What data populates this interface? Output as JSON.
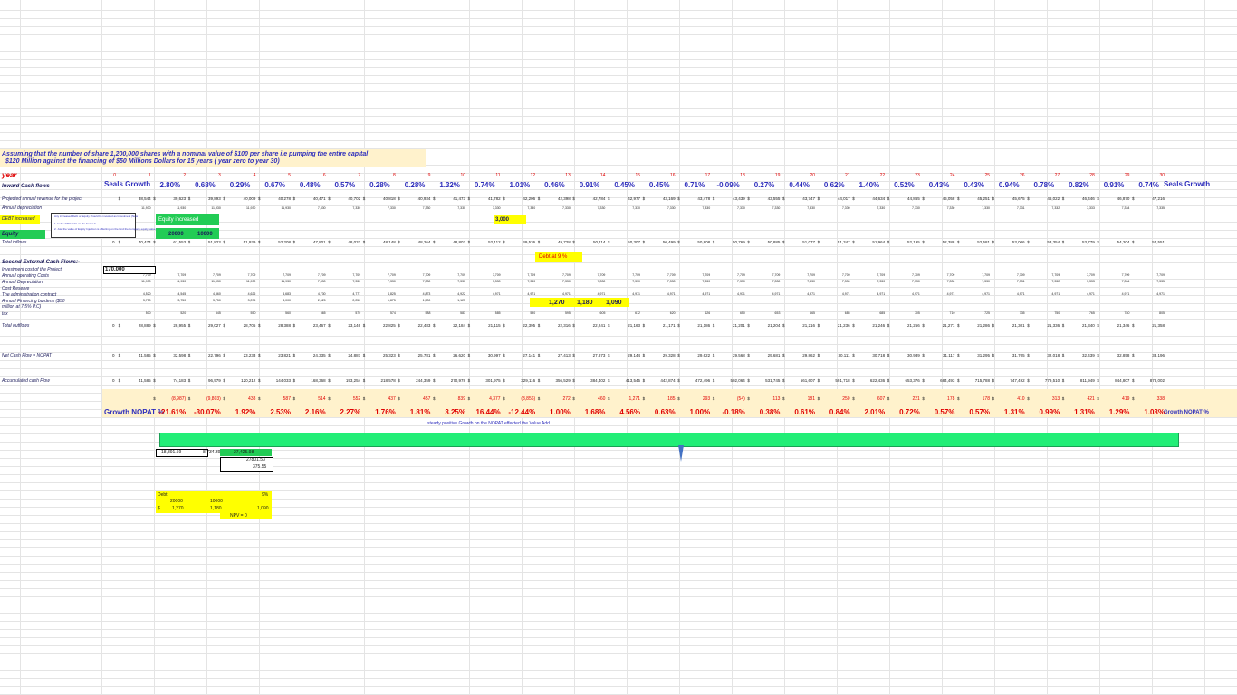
{
  "header": {
    "note_line1": "Assuming that the number of share 1,200,000 shares with a nominal value of $100 per share  i.e pumping the entire capital",
    "note_line2": "$120 Million against the financing of $50 Millions Dollars for 15 years ( year zero to year 30)"
  },
  "year_label": "year",
  "years": [
    "0",
    "1",
    "2",
    "3",
    "4",
    "5",
    "6",
    "7",
    "8",
    "9",
    "10",
    "11",
    "12",
    "13",
    "14",
    "15",
    "16",
    "17",
    "18",
    "19",
    "20",
    "21",
    "22",
    "23",
    "24",
    "25",
    "26",
    "27",
    "28",
    "29",
    "30"
  ],
  "seals_growth_label": "Seals Growth",
  "seals_growth": [
    "2.80%",
    "0.68%",
    "0.29%",
    "0.67%",
    "0.48%",
    "0.57%",
    "0.28%",
    "0.28%",
    "1.32%",
    "0.74%",
    "1.01%",
    "0.46%",
    "0.91%",
    "0.45%",
    "0.45%",
    "0.71%",
    "-0.09%",
    "0.27%",
    "0.44%",
    "0.62%",
    "1.40%",
    "0.52%",
    "0.43%",
    "0.43%",
    "0.94%",
    "0.78%",
    "0.82%",
    "0.91%",
    "0.74%"
  ],
  "labels": {
    "inward": "Inward Cash flows",
    "projected_revenue": "Projected annual revenue for the project",
    "annual_depreciation": "Annual depreciation",
    "debt_increased": "DEBT increased",
    "equity": "Equity",
    "total_inflows": "Total inflows",
    "second_external": "Second External Cash Flows:-",
    "investment_cost": "Investment cost of the Project",
    "annual_operating": "Annual operating Costs",
    "annual_depreciation2": "Annual Depreciation",
    "cost_reserve": "Cost Reserve",
    "admin_contract": "The administration contract",
    "annual_financing": "Annual Financing burdens ($50",
    "annual_financing2": "million at 7.5% P.C)",
    "tax": "tax",
    "total_outflows": "Total outflows",
    "net_cash_flow": "Net Cash Flow = NOPAT",
    "accumulated": "Accumulated cash Flow",
    "growth_nopat": "Growth NOPAT %"
  },
  "debt_note": [
    "Any increased Debt or Equity should be invested as Investment (New",
    "1. In the NPV Debt on the End = 0",
    "2. Just the value of Equity Injection is affecting on the End the company equity value (20%)"
  ],
  "equity_increased": "Equity increased",
  "equity_values": [
    "20000",
    "10000"
  ],
  "debt_3000": "3,000",
  "debt_at_9": "Debt at 9 %",
  "investment_cost_value": "170,000",
  "revenue": [
    "38,544",
    "39,623",
    "39,893",
    "40,009",
    "40,278",
    "40,471",
    "40,702",
    "40,818",
    "40,934",
    "41,473",
    "41,782",
    "42,206",
    "42,398",
    "42,784",
    "42,977",
    "43,169",
    "43,478",
    "43,439",
    "43,555",
    "43,747",
    "44,017",
    "44,634",
    "44,865",
    "45,058",
    "45,251",
    "45,675",
    "46,022",
    "46,446",
    "46,870",
    "47,216"
  ],
  "depreciation": [
    "11,930",
    "11,930",
    "11,930",
    "11,930",
    "11,930",
    "7,330",
    "7,330",
    "7,330",
    "7,330",
    "7,330",
    "7,330",
    "7,330",
    "7,330",
    "7,330",
    "7,330",
    "7,330",
    "7,330",
    "7,330",
    "7,330",
    "7,330",
    "7,330",
    "7,330",
    "7,330",
    "7,330",
    "7,330",
    "7,331",
    "7,332",
    "7,333",
    "7,334",
    "7,335"
  ],
  "total_inflows": [
    "70,474",
    "61,553",
    "51,823",
    "51,939",
    "52,208",
    "47,801",
    "48,032",
    "48,148",
    "48,264",
    "48,803",
    "52,112",
    "49,536",
    "49,728",
    "50,114",
    "50,307",
    "50,499",
    "50,808",
    "50,769",
    "50,885",
    "51,077",
    "51,347",
    "51,964",
    "52,195",
    "52,388",
    "52,581",
    "53,006",
    "53,354",
    "53,779",
    "54,204",
    "54,551"
  ],
  "operating": [
    "7,709",
    "7,709",
    "7,709",
    "7,709",
    "7,709",
    "7,709",
    "7,709",
    "7,709",
    "7,709",
    "7,709",
    "7,709",
    "7,709",
    "7,709",
    "7,709",
    "7,709",
    "7,709",
    "7,709",
    "7,709",
    "7,709",
    "7,709",
    "7,709",
    "7,709",
    "7,709",
    "7,709",
    "7,709",
    "7,709",
    "7,709",
    "7,709",
    "7,709",
    "7,709"
  ],
  "admin": [
    "4,520",
    "4,545",
    "4,560",
    "4,626",
    "4,683",
    "4,730",
    "4,777",
    "4,825",
    "4,873",
    "4,922",
    "4,971",
    "4,971",
    "4,971",
    "4,971",
    "4,971",
    "4,971",
    "4,971",
    "4,971",
    "4,971",
    "4,971",
    "4,971",
    "4,971",
    "4,971",
    "4,971",
    "4,971",
    "4,971",
    "4,971",
    "4,971",
    "4,971",
    "4,971"
  ],
  "financing": [
    "3,750",
    "3,750",
    "3,750",
    "3,375",
    "3,000",
    "2,625",
    "2,250",
    "1,875",
    "1,500",
    "1,125"
  ],
  "financing_highlight": [
    "1,270",
    "1,180",
    "1,090"
  ],
  "tax": [
    "500",
    "520",
    "545",
    "550",
    "560",
    "565",
    "570",
    "574",
    "588",
    "583",
    "585",
    "590",
    "595",
    "605",
    "612",
    "620",
    "626",
    "650",
    "653",
    "665",
    "685",
    "685",
    "705",
    "710",
    "725",
    "735",
    "750",
    "765",
    "780",
    "805"
  ],
  "total_outflows": [
    "28,889",
    "28,955",
    "29,027",
    "28,705",
    "28,388",
    "23,467",
    "23,146",
    "22,825",
    "22,483",
    "22,184",
    "21,115",
    "22,395",
    "22,316",
    "22,241",
    "21,163",
    "21,171",
    "21,186",
    "21,201",
    "21,204",
    "21,216",
    "21,236",
    "21,246",
    "21,256",
    "21,271",
    "21,286",
    "21,301",
    "21,336",
    "21,340",
    "21,346",
    "21,358"
  ],
  "nopat": [
    "41,585",
    "32,598",
    "22,796",
    "23,233",
    "23,821",
    "24,335",
    "24,887",
    "25,323",
    "25,781",
    "26,620",
    "30,997",
    "27,141",
    "27,413",
    "27,873",
    "29,144",
    "29,328",
    "29,622",
    "29,568",
    "29,681",
    "29,862",
    "30,111",
    "30,718",
    "30,939",
    "31,117",
    "31,295",
    "31,705",
    "32,018",
    "32,439",
    "32,858",
    "33,196"
  ],
  "accumulated": [
    "41,585",
    "74,183",
    "96,979",
    "120,212",
    "144,033",
    "168,368",
    "193,254",
    "218,578",
    "244,359",
    "270,978",
    "301,975",
    "329,116",
    "356,529",
    "384,402",
    "413,545",
    "442,874",
    "472,496",
    "502,064",
    "531,745",
    "561,607",
    "591,718",
    "622,436",
    "653,376",
    "684,493",
    "715,788",
    "747,492",
    "779,510",
    "811,949",
    "844,807",
    "878,002"
  ],
  "growth_nopat_values": [
    "(8,987)",
    "(9,803)",
    "438",
    "587",
    "514",
    "552",
    "437",
    "457",
    "839",
    "4,377",
    "(3,856)",
    "272",
    "460",
    "1,271",
    "185",
    "293",
    "(54)",
    "113",
    "181",
    "250",
    "607",
    "221",
    "178",
    "178",
    "410",
    "313",
    "421",
    "419",
    "338"
  ],
  "growth_nopat_pct": [
    "-21.61%",
    "-30.07%",
    "1.92%",
    "2.53%",
    "2.16%",
    "2.27%",
    "1.76%",
    "1.81%",
    "3.25%",
    "16.44%",
    "-12.44%",
    "1.00%",
    "1.68%",
    "4.56%",
    "0.63%",
    "1.00%",
    "-0.18%",
    "0.38%",
    "0.61%",
    "0.84%",
    "2.01%",
    "0.72%",
    "0.57%",
    "0.57%",
    "1.31%",
    "0.99%",
    "1.31%",
    "1.29%",
    "1.03%"
  ],
  "steady_note": "steady positive Growth on the NOPAT effected the Value Add",
  "summary": {
    "v1": "18,891.59",
    "v2": "8,734.39",
    "v3": "27,425.98",
    "v4": "27801.53",
    "v5": "375.55"
  },
  "debt_table": {
    "title": "Debt",
    "rate": "9%",
    "a": "20000",
    "b": "10000",
    "c": "1,270",
    "d": "1,180",
    "e": "1,090",
    "npv": "NPV = 0"
  },
  "colors": {
    "accent_blue": "#2e2ebc",
    "red": "#e00000",
    "band": "#fff2cc",
    "yellow": "#ffff00",
    "green": "#22cc55",
    "bar_green": "#22ee77"
  }
}
